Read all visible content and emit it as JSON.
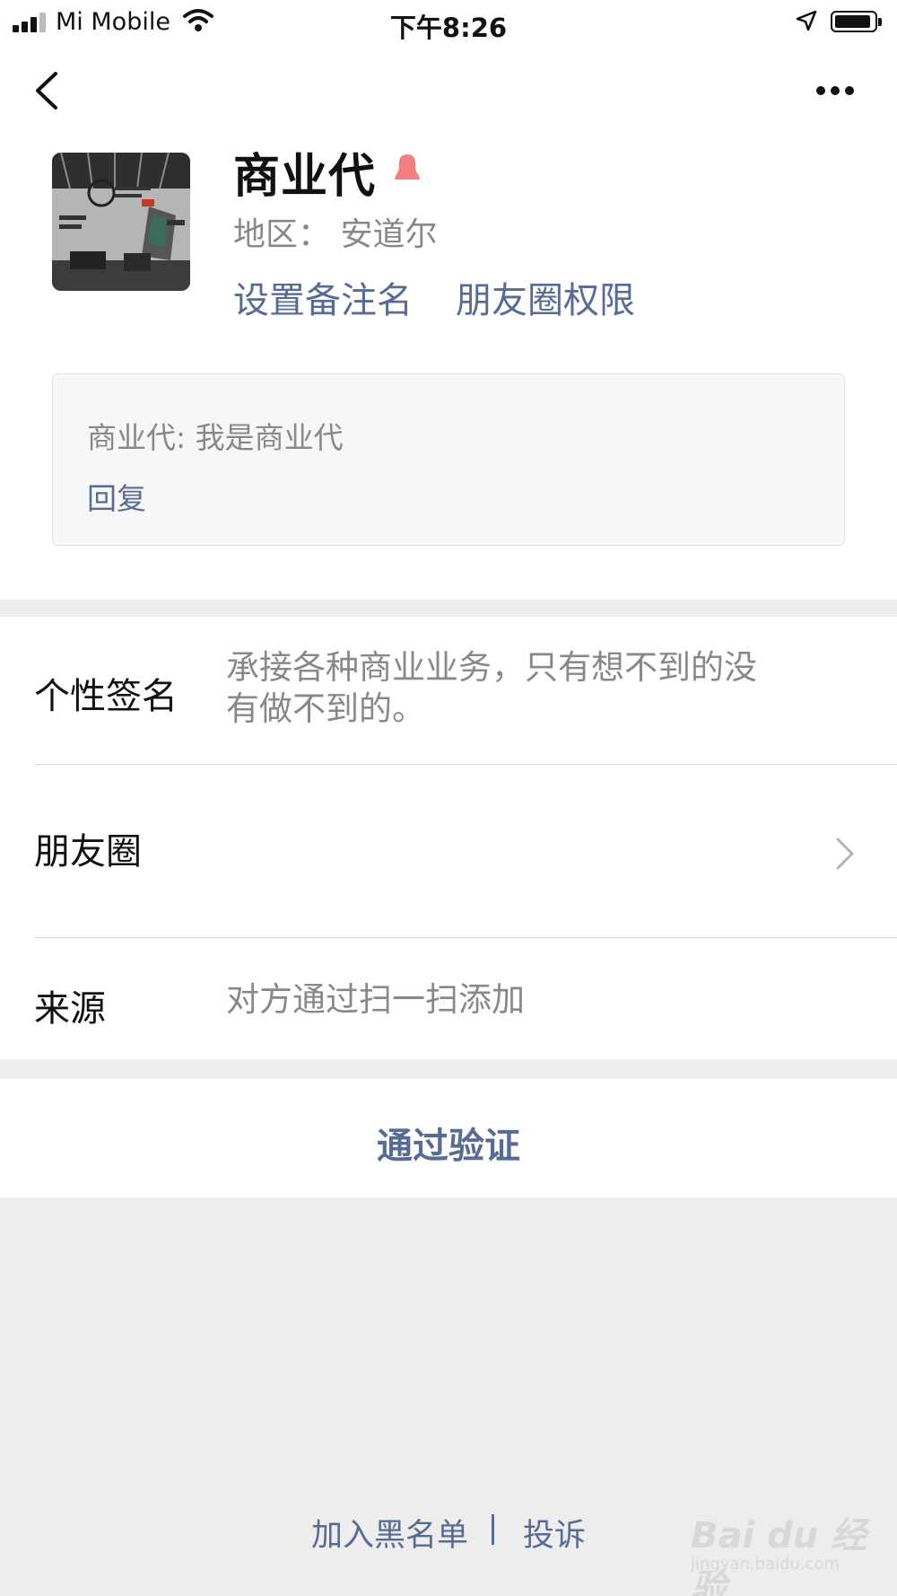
{
  "status_bar": {
    "carrier": "Mi Mobile",
    "time": "下午8:26",
    "battery_level": 0.85
  },
  "profile": {
    "name": "商业代",
    "region": "地区：  安道尔",
    "set_remark_label": "设置备注名",
    "moments_permission_label": "朋友圈权限"
  },
  "message": {
    "text": "商业代: 我是商业代",
    "reply_label": "回复"
  },
  "info": {
    "signature_label": "个性签名",
    "signature_line1": "承接各种商业业务，只有想不到的没",
    "signature_line2": "有做不到的。",
    "moments_label": "朋友圈",
    "source_label": "来源",
    "source_value": "对方通过扫一扫添加"
  },
  "action": {
    "verify_label": "通过验证"
  },
  "footer": {
    "blacklist_label": "加入黑名单",
    "report_label": "投诉"
  },
  "watermark": {
    "brand": "Bai du 经验",
    "url": "jingyan.baidu.com"
  },
  "colors": {
    "link": "#576b95",
    "gray_text": "#888888",
    "background": "#ededed",
    "gender_female": "#f37e7d"
  }
}
